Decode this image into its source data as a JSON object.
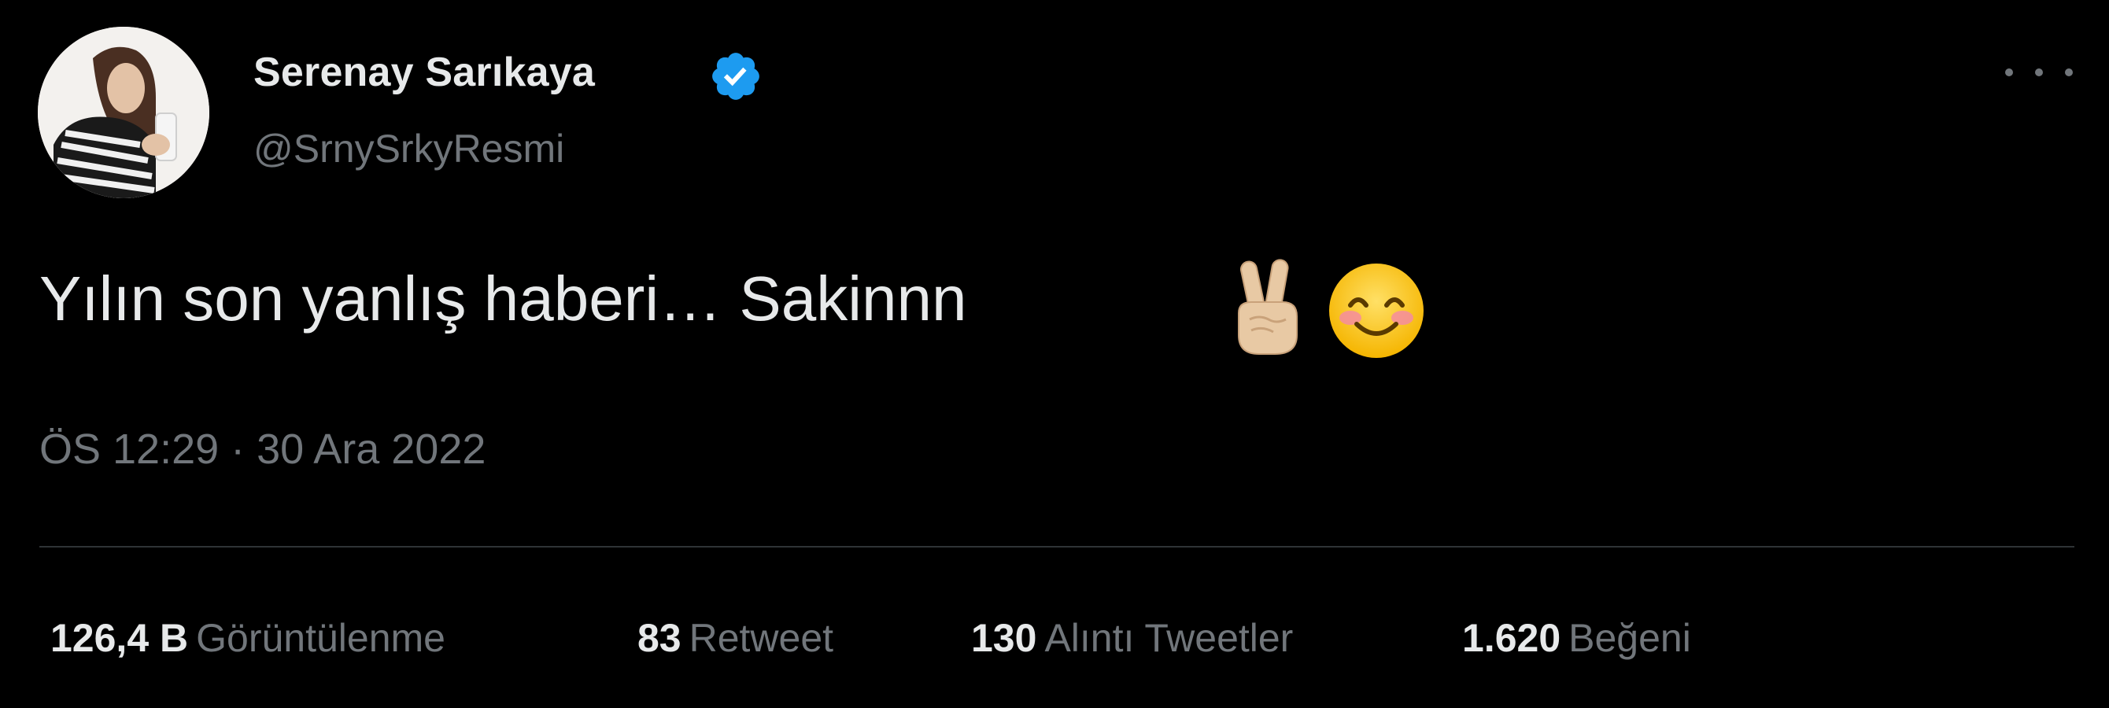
{
  "author": {
    "display_name": "Serenay Sarıkaya",
    "handle": "@SrnySrkyResmi",
    "verified": true
  },
  "tweet": {
    "text": "Yılın son yanlış haberi… Sakinnn",
    "emojis": [
      "victory-hand-emoji",
      "smiling-face-with-smiling-eyes-emoji"
    ],
    "timestamp": "ÖS 12:29 · 30 Ara 2022"
  },
  "stats": {
    "views_count": "126,4 B",
    "views_label": "Görüntülenme",
    "retweets_count": "83",
    "retweets_label": "Retweet",
    "quotes_count": "130",
    "quotes_label": "Alıntı Tweetler",
    "likes_count": "1.620",
    "likes_label": "Beğeni"
  },
  "icons": {
    "verified": "verified-badge-icon",
    "more": "more-options-icon"
  },
  "colors": {
    "background": "#000000",
    "primary_text": "#e7e9ea",
    "secondary_text": "#71767b",
    "verified_blue": "#1d9bf0",
    "divider": "#2f3336"
  }
}
